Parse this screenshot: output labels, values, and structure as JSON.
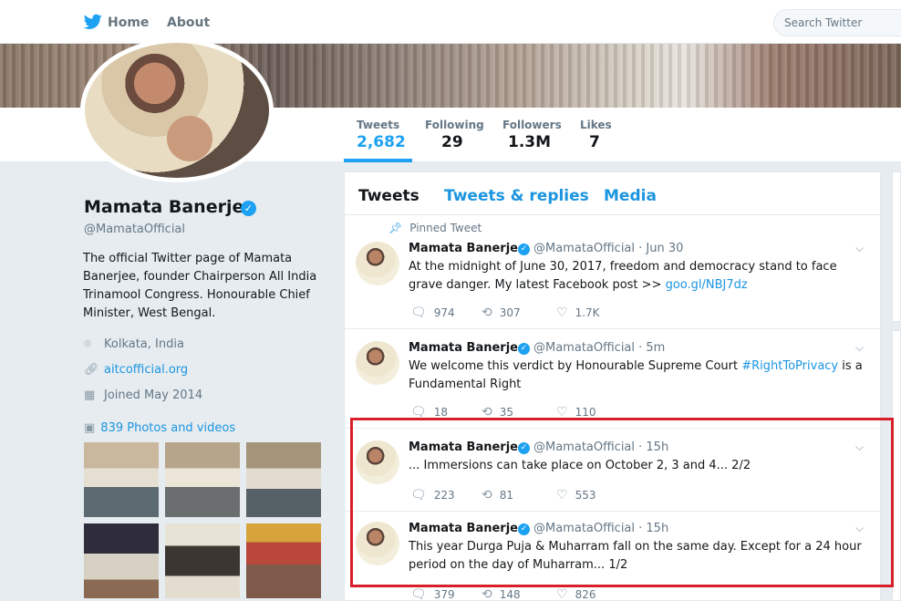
{
  "nav": {
    "home": "Home",
    "about": "About",
    "search_placeholder": "Search Twitter"
  },
  "stats": {
    "tweets_label": "Tweets",
    "tweets_value": "2,682",
    "following_label": "Following",
    "following_value": "29",
    "followers_label": "Followers",
    "followers_value": "1.3M",
    "likes_label": "Likes",
    "likes_value": "7"
  },
  "profile": {
    "name": "Mamata Banerjee",
    "handle": "@MamataOfficial",
    "bio": "The official Twitter page of Mamata Banerjee, founder Chairperson All India Trinamool Congress. Honourable Chief Minister, West Bengal.",
    "location": "Kolkata, India",
    "website": "aitcofficial.org",
    "joined": "Joined May 2014",
    "photos": "839 Photos and videos"
  },
  "tabs": {
    "tweets": "Tweets",
    "replies": "Tweets & replies",
    "media": "Media"
  },
  "tweets": [
    {
      "pinned": "Pinned Tweet",
      "name": "Mamata Banerjee",
      "handle": "@MamataOfficial · Jun 30",
      "text": "At the midnight of June 30, 2017, freedom and democracy stand to face grave danger. My latest Facebook post >> ",
      "link": "goo.gl/NBJ7dz",
      "replies": "974",
      "retweets": "307",
      "likes": "1.7K"
    },
    {
      "name": "Mamata Banerjee",
      "handle": "@MamataOfficial · 5m",
      "text_before": "We welcome this verdict by Honourable Supreme Court ",
      "hashtag": "#RightToPrivacy",
      "text_after": " is a Fundamental Right",
      "replies": "18",
      "retweets": "35",
      "likes": "110"
    },
    {
      "name": "Mamata Banerjee",
      "handle": "@MamataOfficial · 15h",
      "text": "... Immersions can take place on October 2, 3 and 4... 2/2",
      "replies": "223",
      "retweets": "81",
      "likes": "553"
    },
    {
      "name": "Mamata Banerjee",
      "handle": "@MamataOfficial · 15h",
      "text": "This year Durga Puja & Muharram fall on the same day. Except for a 24 hour period on the day of Muharram... 1/2",
      "replies": "379",
      "retweets": "148",
      "likes": "826"
    }
  ],
  "icons": {
    "reply": "reply-icon",
    "retweet": "retweet-icon",
    "like": "heart-icon",
    "verified": "verified-badge-icon",
    "location": "location-pin-icon",
    "link": "link-icon",
    "calendar": "calendar-icon",
    "photo": "photo-icon"
  },
  "colors": {
    "accent": "#1da1f2",
    "link": "#1b95e0",
    "highlight": "#d8202a"
  }
}
